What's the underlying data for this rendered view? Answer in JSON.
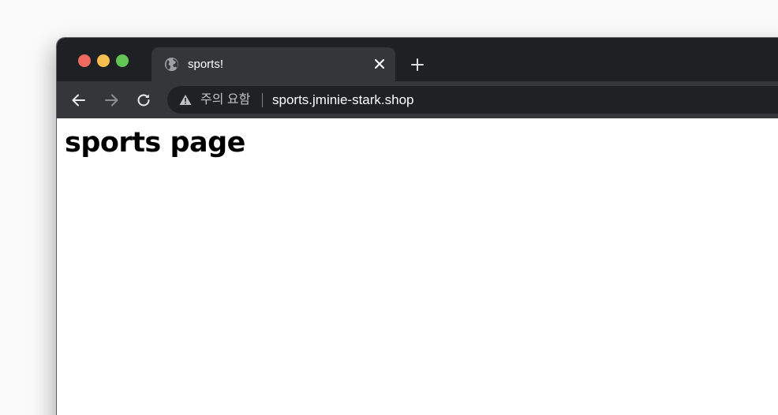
{
  "window": {
    "traffic_lights": [
      "close",
      "minimize",
      "maximize"
    ]
  },
  "tab": {
    "title": "sports!",
    "icon": "globe-icon",
    "close_icon": "close-icon"
  },
  "new_tab": {
    "icon": "plus-icon"
  },
  "toolbar": {
    "back_icon": "arrow-left-icon",
    "forward_icon": "arrow-right-icon",
    "reload_icon": "reload-icon"
  },
  "omnibox": {
    "security_icon": "warning-icon",
    "security_label": "주의 요함",
    "url": "sports.jminie-stark.shop"
  },
  "page": {
    "heading": "sports page"
  },
  "colors": {
    "title_bar": "#1f2023",
    "toolbar": "#35363a",
    "omnibox": "#202124",
    "close_light": "#ee6a5f",
    "minimize_light": "#f5be4f",
    "maximize_light": "#62c554"
  }
}
